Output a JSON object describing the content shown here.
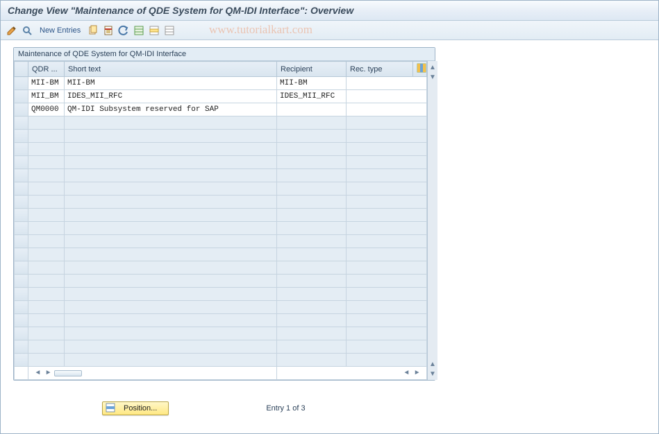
{
  "title": "Change View \"Maintenance of QDE System for QM-IDI Interface\": Overview",
  "toolbar": {
    "new_entries": "New Entries"
  },
  "watermark": "www.tutorialkart.com",
  "grid": {
    "caption": "Maintenance of QDE System for QM-IDI Interface",
    "columns": {
      "qdr": "QDR ...",
      "short_text": "Short text",
      "recipient": "Recipient",
      "rec_type": "Rec. type"
    },
    "rows": [
      {
        "qdr": "MII-BM",
        "short_text": "MII-BM",
        "recipient": "MII-BM",
        "rec_type": ""
      },
      {
        "qdr": "MII_BM",
        "short_text": "IDES_MII_RFC",
        "recipient": "IDES_MII_RFC",
        "rec_type": ""
      },
      {
        "qdr": "QM0000",
        "short_text": "QM-IDI Subsystem reserved for SAP",
        "recipient": "",
        "rec_type": ""
      }
    ],
    "empty_rows": 19
  },
  "footer": {
    "position_label": "Position...",
    "entry_text": "Entry 1 of 3"
  }
}
